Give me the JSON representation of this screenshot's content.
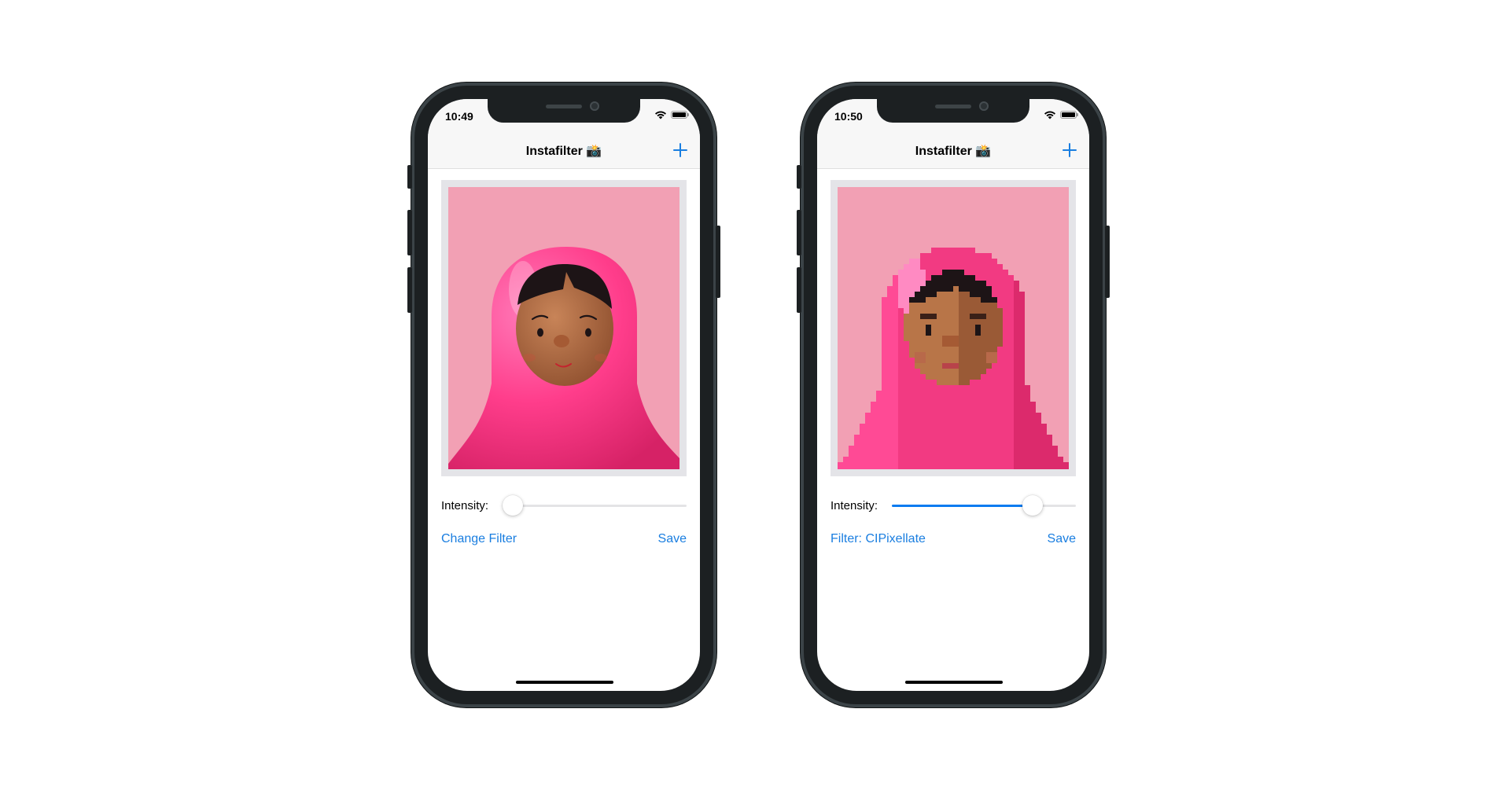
{
  "colors": {
    "accent": "#1a7ee0",
    "slider_fill": "#0a7bf0",
    "photo_background": "#f2a0b4",
    "hood": "#ff3d8b",
    "face": "#b0683f"
  },
  "phones": [
    {
      "status": {
        "time": "10:49",
        "wifi_icon": "wifi-icon",
        "battery_icon": "battery-icon"
      },
      "nav": {
        "title": "Instafilter 📸",
        "add_icon": "plus-icon"
      },
      "intensity": {
        "label": "Intensity:",
        "value": 0.0
      },
      "filter_button": "Change Filter",
      "save_button": "Save",
      "image": {
        "pixellated": false
      }
    },
    {
      "status": {
        "time": "10:50",
        "wifi_icon": "wifi-icon",
        "battery_icon": "battery-icon"
      },
      "nav": {
        "title": "Instafilter 📸",
        "add_icon": "plus-icon"
      },
      "intensity": {
        "label": "Intensity:",
        "value": 0.8
      },
      "filter_button": "Filter: CIPixellate",
      "save_button": "Save",
      "image": {
        "pixellated": true
      }
    }
  ]
}
